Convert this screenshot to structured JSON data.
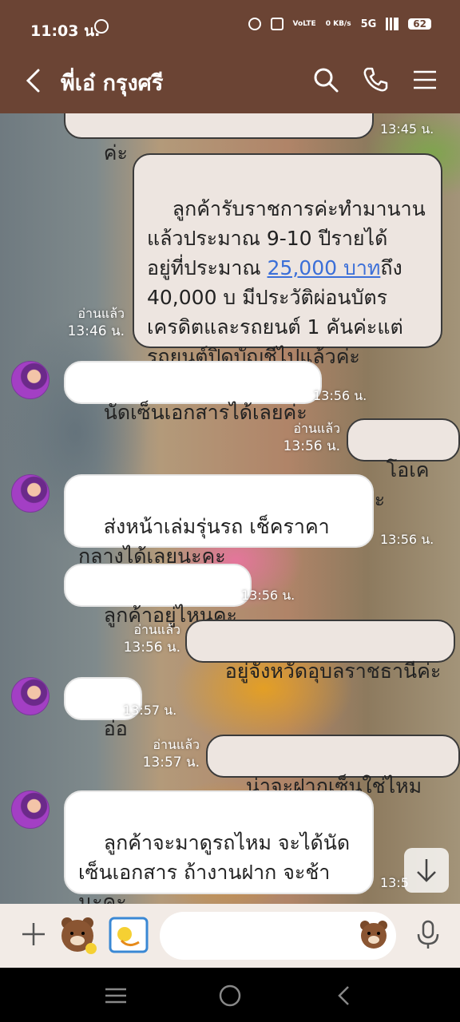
{
  "status_bar": {
    "time": "11:03 น.",
    "network": "5G",
    "data_speed": "0 KB/s",
    "lte_label": "VoLTE",
    "battery": "62"
  },
  "header": {
    "contact_name": "พี่เอ๋ กรุงศรี",
    "icons": [
      "back-icon",
      "search-icon",
      "phone-icon",
      "menu-icon"
    ]
  },
  "messages": [
    {
      "dir": "out",
      "text": "ค่ะ",
      "time": "13:45 น."
    },
    {
      "dir": "out",
      "text_parts": [
        "ลูกค้ารับราชการค่ะทำมานาน\nแล้วประมาณ 9-10 ปีรายได้\nอยู่ที่ประมาณ ",
        "25,000 บาท",
        "ถึง\n40,000 บ มีประวัติผ่อนบัตร\nเครดิตและรถยนต์ 1 คันค่ะแต่\nรถยนต์ปิดบัญชีไปแล้วค่ะ"
      ],
      "read": "อ่านแล้ว",
      "time": "13:46 น."
    },
    {
      "dir": "in",
      "text": "นัดเซ็นเอกสารได้เลยค่ะ",
      "time": "13:56 น."
    },
    {
      "dir": "out",
      "text": "โอเคค่ะ",
      "read": "อ่านแล้ว",
      "time": "13:56 น."
    },
    {
      "dir": "in",
      "text": "ส่งหน้าเล่มรุ่นรถ เช็คราคา\nกลางได้เลยนะคะ",
      "time": "13:56 น."
    },
    {
      "dir": "in",
      "text": "ลูกค้าอยู่ไหนคะ",
      "time": "13:56 น."
    },
    {
      "dir": "out",
      "text": "อยู่จังหวัดอุบลราชธานีค่ะ",
      "read": "อ่านแล้ว",
      "time": "13:56 น."
    },
    {
      "dir": "in",
      "text": "อ่อ",
      "time": "13:57 น."
    },
    {
      "dir": "out",
      "text": "น่าจะฝากเซ็นใช่ไหมคะ",
      "read": "อ่านแล้ว",
      "time": "13:57 น."
    },
    {
      "dir": "in",
      "text": "ลูกค้าจะมาดูรถไหม จะได้นัด\nเซ็นเอกสาร ถ้างานฝาก จะช้า\nนะคะ",
      "time": "13:5"
    }
  ],
  "input": {
    "placeholder": ""
  },
  "colors": {
    "header_bg": "#6b4434",
    "input_bar_bg": "#f2ebe6",
    "link": "#3b6fd8"
  }
}
